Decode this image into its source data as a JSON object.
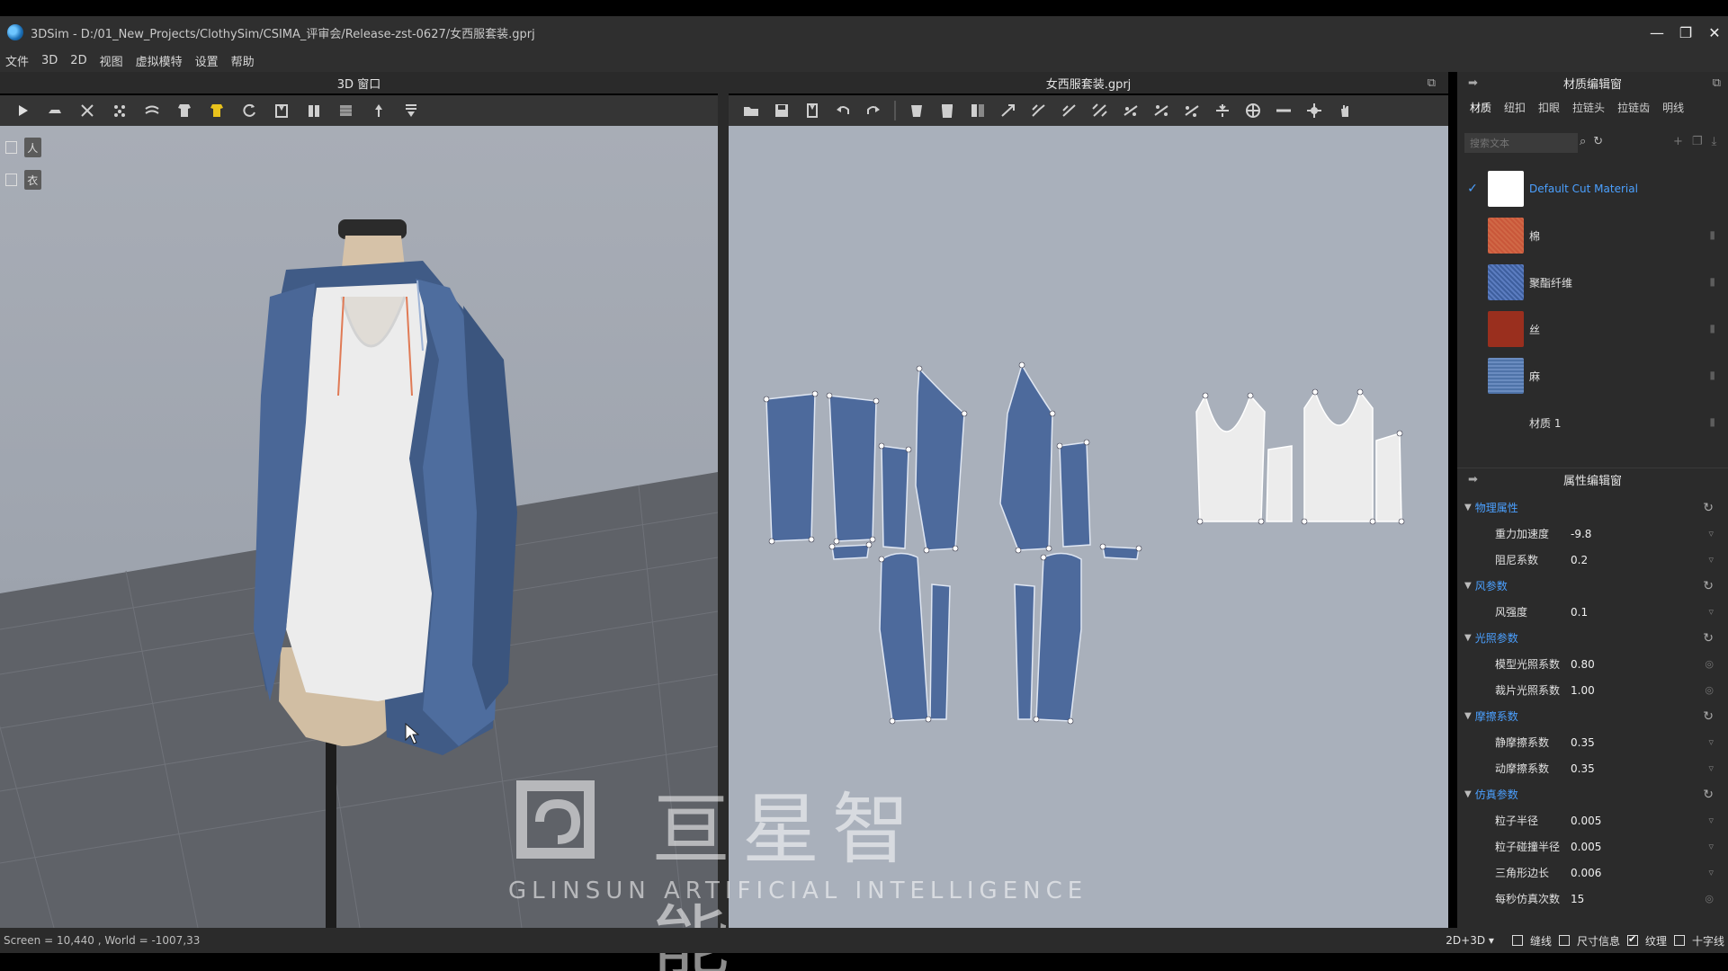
{
  "window": {
    "title": "3DSim - D:/01_New_Projects/ClothySim/CSIMA_评审会/Release-zst-0627/女西服套装.gprj",
    "minimize": "—",
    "maximize": "❐",
    "close": "✕"
  },
  "menu": [
    "文件",
    "3D",
    "2D",
    "视图",
    "虚拟模特",
    "设置",
    "帮助"
  ],
  "panels": {
    "view3d_title": "3D 窗口",
    "view2d_title": "女西服套装.gprj"
  },
  "material_editor": {
    "title": "材质编辑窗",
    "tabs": [
      "材质",
      "纽扣",
      "扣眼",
      "拉链头",
      "拉链齿",
      "明线"
    ],
    "search_placeholder": "搜索文本",
    "materials": [
      {
        "name": "Default Cut Material",
        "color": "#ffffff",
        "selected": true
      },
      {
        "name": "棉",
        "color": "#c9573a",
        "selected": false
      },
      {
        "name": "聚酯纤维",
        "color": "#3e5f9e",
        "selected": false
      },
      {
        "name": "丝",
        "color": "#9a2f1e",
        "selected": false
      },
      {
        "name": "麻",
        "color": "#4f73a8",
        "selected": false
      },
      {
        "name": "材质 1",
        "color": "",
        "selected": false
      }
    ]
  },
  "property_editor": {
    "title": "属性编辑窗",
    "sections": [
      {
        "name": "物理属性",
        "props": [
          {
            "label": "重力加速度",
            "value": "-9.8"
          },
          {
            "label": "阻尼系数",
            "value": "0.2"
          }
        ]
      },
      {
        "name": "风参数",
        "props": [
          {
            "label": "风强度",
            "value": "0.1"
          }
        ]
      },
      {
        "name": "光照参数",
        "props": [
          {
            "label": "模型光照系数",
            "value": "0.80"
          },
          {
            "label": "裁片光照系数",
            "value": "1.00"
          }
        ]
      },
      {
        "name": "摩擦系数",
        "props": [
          {
            "label": "静摩擦系数",
            "value": "0.35"
          },
          {
            "label": "动摩擦系数",
            "value": "0.35"
          }
        ]
      },
      {
        "name": "仿真参数",
        "props": [
          {
            "label": "粒子半径",
            "value": "0.005"
          },
          {
            "label": "粒子碰撞半径",
            "value": "0.005"
          },
          {
            "label": "三角形边长",
            "value": "0.006"
          },
          {
            "label": "每秒仿真次数",
            "value": "15"
          }
        ]
      }
    ]
  },
  "status": {
    "text": "Screen = 10,440 , World = -1007,33",
    "mode": "2D+3D ▾",
    "toggles": [
      {
        "label": "缝线",
        "checked": false
      },
      {
        "label": "尺寸信息",
        "checked": false
      },
      {
        "label": "纹理",
        "checked": true
      },
      {
        "label": "十字线",
        "checked": false
      }
    ]
  },
  "watermark": {
    "brand": "亘星智能",
    "tagline": "GLINSUN ARTIFICIAL INTELLIGENCE"
  },
  "colors": {
    "accent": "#4ba0ff",
    "pattern_fabric": "#4d6a9c",
    "viewport_bg": "#a9b0bb"
  }
}
